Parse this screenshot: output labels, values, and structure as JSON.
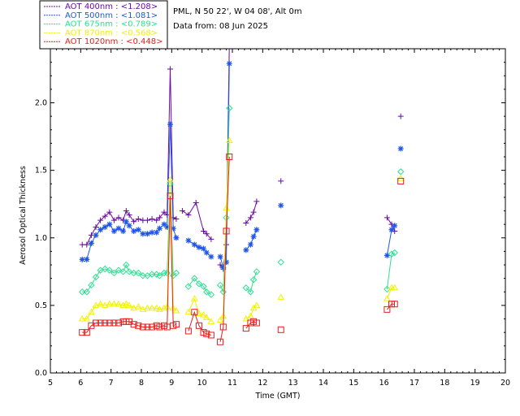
{
  "header": {
    "site_line": "PML, N 50 22', W 04 08', Alt 0m",
    "date_line": "Data from: 08 Jun 2025"
  },
  "legend": [
    {
      "label": "AOT  400nm : <1.208>",
      "color": "#6a0aa0"
    },
    {
      "label": "AOT  500nm : <1.081>",
      "color": "#1f56e8"
    },
    {
      "label": "AOT  675nm : <0.789>",
      "color": "#2de090"
    },
    {
      "label": "AOT  870nm : <0.568>",
      "color": "#f2f200"
    },
    {
      "label": "AOT 1020nm : <0.448>",
      "color": "#ea1c1c"
    }
  ],
  "chart_data": {
    "type": "line",
    "xlabel": "Time (GMT)",
    "ylabel": "Aerosol Optical Thickness",
    "xlim": [
      5,
      20
    ],
    "ylim": [
      0.0,
      2.4
    ],
    "xticks": [
      "5",
      "6",
      "7",
      "8",
      "9",
      "10",
      "11",
      "12",
      "13",
      "14",
      "15",
      "16",
      "17",
      "18",
      "19",
      "20"
    ],
    "yticks": [
      "0.0",
      "0.5",
      "1.0",
      "1.5",
      "2.0"
    ],
    "series": [
      {
        "name": "AOT  400nm : <1.208>",
        "color": "#6a0aa0",
        "marker": "plus",
        "segments": [
          [
            [
              6.05,
              0.95
            ],
            [
              6.2,
              0.95
            ],
            [
              6.35,
              1.02
            ],
            [
              6.5,
              1.08
            ],
            [
              6.65,
              1.13
            ],
            [
              6.8,
              1.16
            ],
            [
              6.95,
              1.19
            ],
            [
              7.1,
              1.13
            ],
            [
              7.25,
              1.15
            ],
            [
              7.4,
              1.13
            ],
            [
              7.5,
              1.2
            ],
            [
              7.6,
              1.17
            ],
            [
              7.75,
              1.12
            ],
            [
              7.9,
              1.14
            ],
            [
              8.05,
              1.13
            ],
            [
              8.2,
              1.13
            ],
            [
              8.35,
              1.14
            ],
            [
              8.5,
              1.13
            ],
            [
              8.6,
              1.15
            ],
            [
              8.75,
              1.19
            ],
            [
              8.85,
              1.17
            ],
            [
              8.95,
              2.25
            ],
            [
              9.05,
              1.15
            ],
            [
              9.15,
              1.14
            ]
          ],
          [
            [
              9.35,
              1.2
            ],
            [
              9.55,
              1.17
            ],
            [
              9.8,
              1.26
            ],
            [
              10.05,
              1.05
            ],
            [
              10.15,
              1.03
            ],
            [
              10.3,
              0.99
            ]
          ],
          [
            [
              10.6,
              0.8
            ],
            [
              10.7,
              0.77
            ],
            [
              10.8,
              0.95
            ],
            [
              10.9,
              2.45
            ]
          ],
          [
            [
              11.45,
              1.11
            ],
            [
              11.6,
              1.15
            ],
            [
              11.7,
              1.19
            ],
            [
              11.8,
              1.27
            ]
          ],
          [
            [
              12.6,
              1.42
            ]
          ],
          [
            [
              16.1,
              1.15
            ],
            [
              16.25,
              1.1
            ],
            [
              16.35,
              1.05
            ]
          ],
          [
            [
              16.55,
              1.9
            ]
          ]
        ]
      },
      {
        "name": "AOT  500nm : <1.081>",
        "color": "#1f56e8",
        "marker": "asterisk",
        "segments": [
          [
            [
              6.05,
              0.84
            ],
            [
              6.2,
              0.84
            ],
            [
              6.35,
              0.96
            ],
            [
              6.5,
              1.02
            ],
            [
              6.65,
              1.06
            ],
            [
              6.8,
              1.08
            ],
            [
              6.95,
              1.1
            ],
            [
              7.1,
              1.05
            ],
            [
              7.25,
              1.07
            ],
            [
              7.4,
              1.05
            ],
            [
              7.5,
              1.12
            ],
            [
              7.6,
              1.09
            ],
            [
              7.75,
              1.05
            ],
            [
              7.9,
              1.06
            ],
            [
              8.05,
              1.03
            ],
            [
              8.2,
              1.03
            ],
            [
              8.35,
              1.04
            ],
            [
              8.5,
              1.04
            ],
            [
              8.6,
              1.07
            ],
            [
              8.75,
              1.1
            ],
            [
              8.85,
              1.08
            ],
            [
              8.95,
              1.84
            ],
            [
              9.05,
              1.07
            ],
            [
              9.15,
              1.0
            ]
          ],
          [
            [
              9.55,
              0.98
            ],
            [
              9.75,
              0.95
            ],
            [
              9.9,
              0.93
            ],
            [
              10.05,
              0.92
            ],
            [
              10.15,
              0.89
            ],
            [
              10.3,
              0.86
            ]
          ],
          [
            [
              10.6,
              0.86
            ],
            [
              10.7,
              0.78
            ],
            [
              10.8,
              0.82
            ],
            [
              10.9,
              2.29
            ]
          ],
          [
            [
              11.45,
              0.91
            ],
            [
              11.6,
              0.95
            ],
            [
              11.7,
              1.01
            ],
            [
              11.8,
              1.06
            ]
          ],
          [
            [
              12.6,
              1.24
            ]
          ],
          [
            [
              16.1,
              0.87
            ],
            [
              16.25,
              1.06
            ],
            [
              16.35,
              1.09
            ]
          ],
          [
            [
              16.55,
              1.66
            ]
          ]
        ]
      },
      {
        "name": "AOT  675nm : <0.789>",
        "color": "#2de090",
        "marker": "diamond",
        "segments": [
          [
            [
              6.05,
              0.6
            ],
            [
              6.2,
              0.6
            ],
            [
              6.35,
              0.65
            ],
            [
              6.5,
              0.71
            ],
            [
              6.65,
              0.76
            ],
            [
              6.8,
              0.77
            ],
            [
              6.95,
              0.76
            ],
            [
              7.1,
              0.74
            ],
            [
              7.25,
              0.76
            ],
            [
              7.4,
              0.75
            ],
            [
              7.5,
              0.8
            ],
            [
              7.6,
              0.75
            ],
            [
              7.75,
              0.74
            ],
            [
              7.9,
              0.74
            ],
            [
              8.05,
              0.72
            ],
            [
              8.2,
              0.72
            ],
            [
              8.35,
              0.73
            ],
            [
              8.5,
              0.73
            ],
            [
              8.6,
              0.72
            ],
            [
              8.75,
              0.74
            ],
            [
              8.85,
              0.74
            ],
            [
              8.95,
              1.4
            ],
            [
              9.05,
              0.72
            ],
            [
              9.15,
              0.74
            ]
          ],
          [
            [
              9.55,
              0.64
            ],
            [
              9.75,
              0.7
            ],
            [
              9.9,
              0.66
            ],
            [
              10.05,
              0.64
            ],
            [
              10.15,
              0.6
            ],
            [
              10.3,
              0.58
            ]
          ],
          [
            [
              10.6,
              0.65
            ],
            [
              10.7,
              0.6
            ],
            [
              10.8,
              1.15
            ],
            [
              10.9,
              1.96
            ]
          ],
          [
            [
              11.45,
              0.63
            ],
            [
              11.6,
              0.6
            ],
            [
              11.7,
              0.69
            ],
            [
              11.8,
              0.75
            ]
          ],
          [
            [
              12.6,
              0.82
            ]
          ],
          [
            [
              16.1,
              0.62
            ],
            [
              16.25,
              0.88
            ],
            [
              16.35,
              0.89
            ]
          ],
          [
            [
              16.55,
              1.49
            ]
          ]
        ]
      },
      {
        "name": "AOT  870nm : <0.568>",
        "color": "#f2f200",
        "marker": "triangle",
        "segments": [
          [
            [
              6.05,
              0.4
            ],
            [
              6.2,
              0.4
            ],
            [
              6.35,
              0.45
            ],
            [
              6.5,
              0.5
            ],
            [
              6.65,
              0.51
            ],
            [
              6.8,
              0.5
            ],
            [
              6.95,
              0.51
            ],
            [
              7.1,
              0.51
            ],
            [
              7.25,
              0.51
            ],
            [
              7.4,
              0.5
            ],
            [
              7.5,
              0.51
            ],
            [
              7.6,
              0.5
            ],
            [
              7.75,
              0.48
            ],
            [
              7.9,
              0.49
            ],
            [
              8.05,
              0.47
            ],
            [
              8.2,
              0.48
            ],
            [
              8.35,
              0.48
            ],
            [
              8.5,
              0.48
            ],
            [
              8.6,
              0.47
            ],
            [
              8.75,
              0.48
            ],
            [
              8.85,
              0.49
            ],
            [
              8.95,
              1.43
            ],
            [
              9.05,
              0.48
            ],
            [
              9.15,
              0.46
            ]
          ],
          [
            [
              9.55,
              0.45
            ],
            [
              9.75,
              0.55
            ],
            [
              9.9,
              0.44
            ],
            [
              10.05,
              0.43
            ],
            [
              10.15,
              0.41
            ],
            [
              10.3,
              0.38
            ]
          ],
          [
            [
              10.6,
              0.39
            ],
            [
              10.7,
              0.42
            ],
            [
              10.8,
              1.22
            ],
            [
              10.9,
              1.72
            ]
          ],
          [
            [
              11.45,
              0.4
            ],
            [
              11.6,
              0.42
            ],
            [
              11.7,
              0.48
            ],
            [
              11.8,
              0.5
            ]
          ],
          [
            [
              12.6,
              0.56
            ]
          ],
          [
            [
              16.1,
              0.55
            ],
            [
              16.25,
              0.63
            ],
            [
              16.35,
              0.63
            ]
          ],
          [
            [
              16.55,
              1.44
            ]
          ]
        ]
      },
      {
        "name": "AOT 1020nm : <0.448>",
        "color": "#ea1c1c",
        "marker": "square",
        "segments": [
          [
            [
              6.05,
              0.3
            ],
            [
              6.2,
              0.3
            ],
            [
              6.35,
              0.35
            ],
            [
              6.5,
              0.37
            ],
            [
              6.65,
              0.37
            ],
            [
              6.8,
              0.37
            ],
            [
              6.95,
              0.37
            ],
            [
              7.1,
              0.37
            ],
            [
              7.25,
              0.37
            ],
            [
              7.4,
              0.38
            ],
            [
              7.5,
              0.38
            ],
            [
              7.6,
              0.38
            ],
            [
              7.75,
              0.36
            ],
            [
              7.9,
              0.35
            ],
            [
              8.05,
              0.34
            ],
            [
              8.2,
              0.34
            ],
            [
              8.35,
              0.34
            ],
            [
              8.5,
              0.35
            ],
            [
              8.6,
              0.34
            ],
            [
              8.75,
              0.35
            ],
            [
              8.85,
              0.34
            ],
            [
              8.95,
              1.31
            ],
            [
              9.05,
              0.35
            ],
            [
              9.15,
              0.36
            ]
          ],
          [
            [
              9.55,
              0.31
            ],
            [
              9.75,
              0.45
            ],
            [
              9.9,
              0.35
            ],
            [
              10.05,
              0.3
            ],
            [
              10.15,
              0.29
            ],
            [
              10.3,
              0.28
            ]
          ],
          [
            [
              10.6,
              0.23
            ],
            [
              10.7,
              0.34
            ],
            [
              10.8,
              1.05
            ],
            [
              10.9,
              1.6
            ]
          ],
          [
            [
              11.45,
              0.33
            ],
            [
              11.6,
              0.37
            ],
            [
              11.7,
              0.38
            ],
            [
              11.8,
              0.37
            ]
          ],
          [
            [
              12.6,
              0.32
            ]
          ],
          [
            [
              16.1,
              0.47
            ],
            [
              16.25,
              0.51
            ],
            [
              16.35,
              0.51
            ]
          ],
          [
            [
              16.55,
              1.42
            ]
          ]
        ]
      }
    ]
  }
}
